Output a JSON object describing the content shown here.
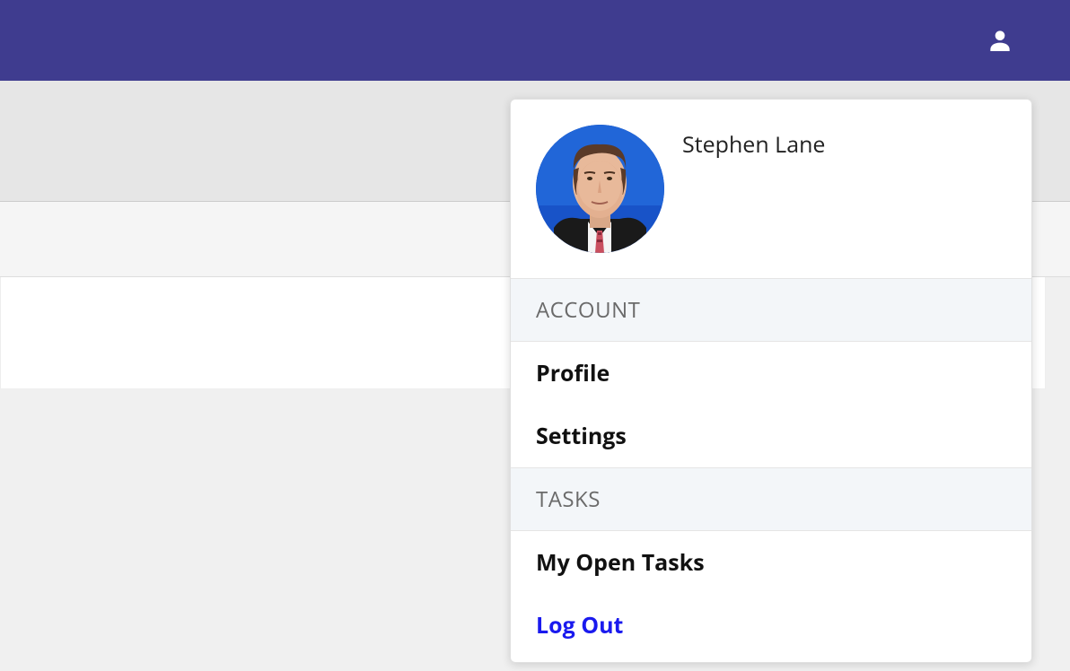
{
  "user": {
    "name": "Stephen Lane"
  },
  "menu": {
    "sections": [
      {
        "header": "ACCOUNT",
        "items": [
          {
            "label": "Profile"
          },
          {
            "label": "Settings"
          }
        ]
      },
      {
        "header": "TASKS",
        "items": [
          {
            "label": "My Open Tasks"
          },
          {
            "label": "Log Out",
            "style": "logout"
          }
        ]
      }
    ]
  }
}
